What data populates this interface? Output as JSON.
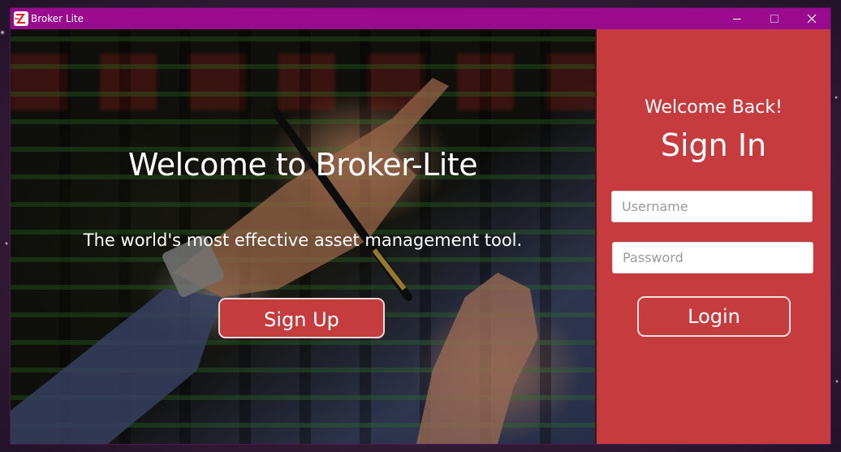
{
  "window": {
    "title": "Broker Lite",
    "icon": "broker-lite-logo-icon",
    "controls": {
      "minimize_icon": "minimize-icon",
      "maximize_icon": "maximize-icon",
      "close_icon": "close-icon"
    },
    "titlebar_color": "#9a0a8e"
  },
  "hero": {
    "title": "Welcome to Broker-Lite",
    "tagline": "The world's most effective asset management tool.",
    "signup_label": "Sign Up"
  },
  "signin": {
    "greeting": "Welcome Back!",
    "title": "Sign In",
    "username_placeholder": "Username",
    "username_value": "",
    "password_placeholder": "Password",
    "password_value": "",
    "login_label": "Login",
    "panel_color": "#c63c3e"
  }
}
